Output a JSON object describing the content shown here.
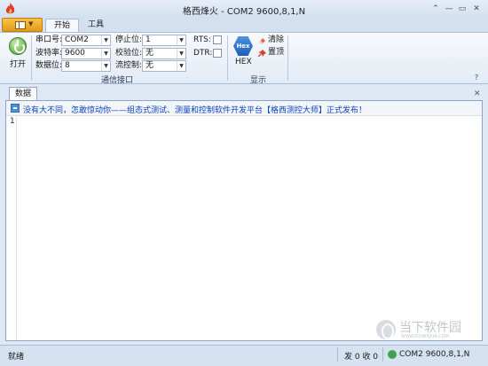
{
  "window": {
    "title": "格西烽火 - COM2  9600,8,1,N",
    "controls": [
      "⌃",
      "—",
      "▭",
      "✕"
    ]
  },
  "ribbon": {
    "tabs": [
      "开始",
      "工具"
    ],
    "open_label": "打开",
    "serial": {
      "port_label": "串口号:",
      "port_value": "COM2",
      "baud_label": "波特率:",
      "baud_value": "9600",
      "databits_label": "数据位:",
      "databits_value": "8",
      "stopbits_label": "停止位:",
      "stopbits_value": "1",
      "parity_label": "校验位:",
      "parity_value": "无",
      "flow_label": "流控制:",
      "flow_value": "无",
      "rts_label": "RTS:",
      "dtr_label": "DTR:",
      "group_label": "通信接口"
    },
    "display": {
      "hex_icon_text": "Hex",
      "hex_label": "HEX",
      "clear_label": "清除",
      "top_label": "置顶",
      "group_label": "显示"
    }
  },
  "document": {
    "tab_label": "数据",
    "info_text": "没有大不同，怎敢惊动你——组态式测试、测量和控制软件开发平台【格西测控大师】正式发布！",
    "line_number": "1"
  },
  "status": {
    "ready": "就绪",
    "counts": "发 0  收 0",
    "port": "COM2  9600,8,1,N"
  },
  "watermark": {
    "text": "当下软件园",
    "sub": "WWW.DOWNXIA.COM"
  }
}
